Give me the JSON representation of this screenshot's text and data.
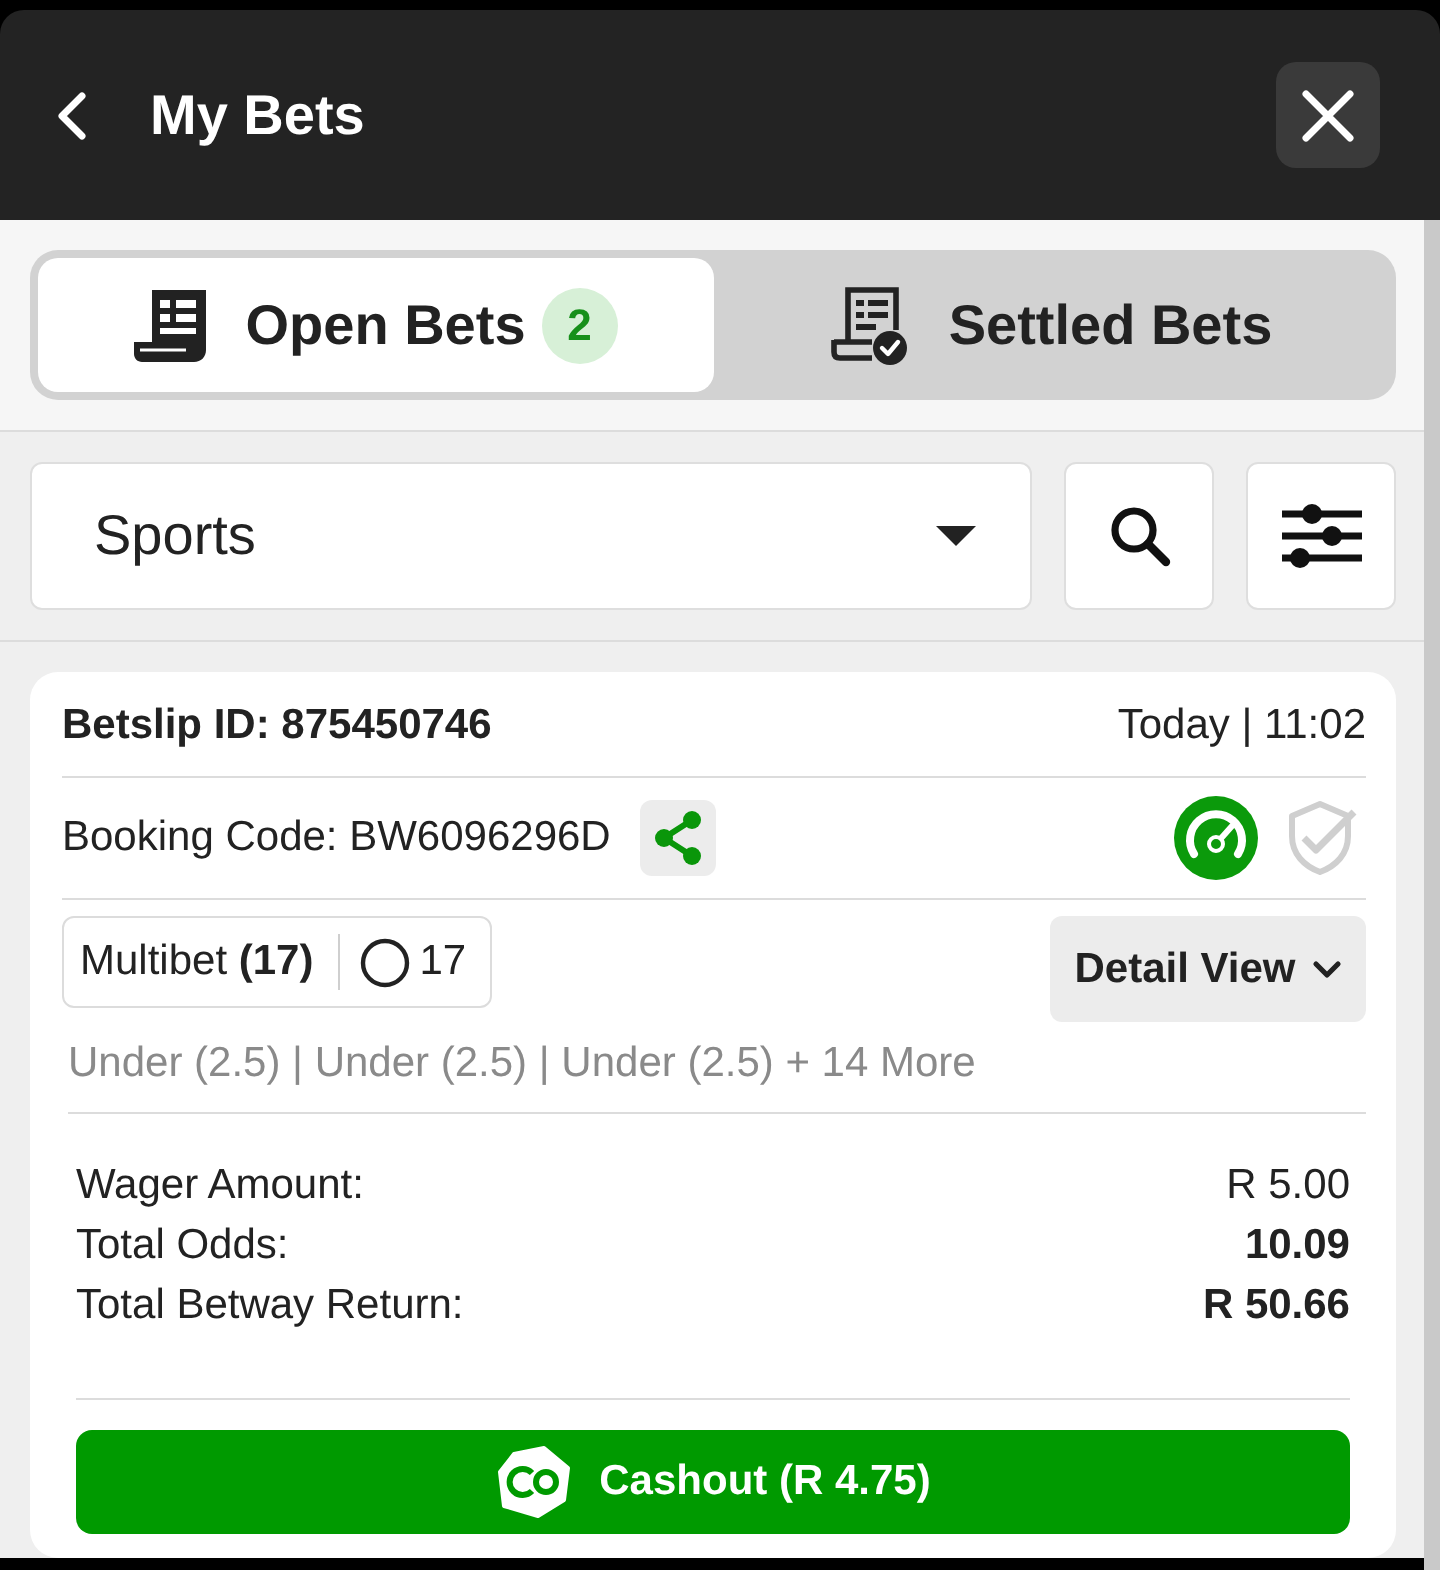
{
  "header": {
    "title": "My Bets"
  },
  "tabs": [
    {
      "label": "Open Bets",
      "badge": "2",
      "selected": true
    },
    {
      "label": "Settled Bets",
      "selected": false
    }
  ],
  "filters": {
    "category": "Sports"
  },
  "bets": [
    {
      "betslip": "Betslip ID: 875450746",
      "placed": "Today | 11:02",
      "booking": "Booking Code: BW6096296D",
      "indicators": [
        {
          "kind": "gauge",
          "active": true
        },
        {
          "kind": "shield",
          "active": false
        }
      ],
      "bet_type": "Multibet **(17)**",
      "legs": "17",
      "detail_button": "Detail View",
      "selections": "Under (2.5) | Under (2.5) | Under (2.5) + 14 More",
      "summary": [
        {
          "label": "Wager Amount:",
          "value": "R 5.00",
          "bold": false
        },
        {
          "label": "Total Odds:",
          "value": "10.09",
          "bold": true
        },
        {
          "label": "Total Betway Return:",
          "value": "R 50.66",
          "bold": true
        }
      ],
      "cashout_button": "Cashout (R 4.75)"
    }
  ]
}
